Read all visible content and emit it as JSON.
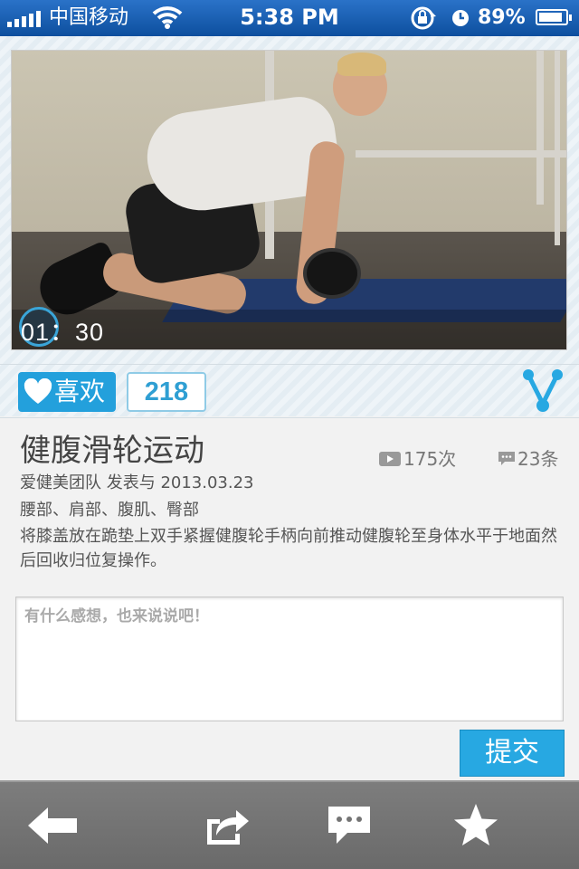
{
  "status_bar": {
    "carrier": "中国移动",
    "time": "5:38 PM",
    "battery_text": "89%",
    "battery_level": 0.89
  },
  "video": {
    "duration": "01：30"
  },
  "like": {
    "label": "喜欢",
    "count": "218"
  },
  "workout": {
    "title": "健腹滑轮运动",
    "views": "175次",
    "comments": "23条",
    "meta": "爱健美团队  发表与  2013.03.23",
    "tags": "腰部、肩部、腹肌、臀部",
    "description": "将膝盖放在跪垫上双手紧握健腹轮手柄向前推动健腹轮至身体水平于地面然后回收归位复操作。"
  },
  "comment": {
    "placeholder": "有什么感想，也来说说吧！",
    "value": "",
    "submit_label": "提交"
  },
  "toolbar": {
    "items": [
      "back-arrow-icon",
      "share-icon",
      "comment-icon",
      "favorite-star-icon"
    ]
  },
  "colors": {
    "status_bar": "#1a5fb0",
    "accent": "#23a0dc",
    "toolbar": "#747474"
  }
}
